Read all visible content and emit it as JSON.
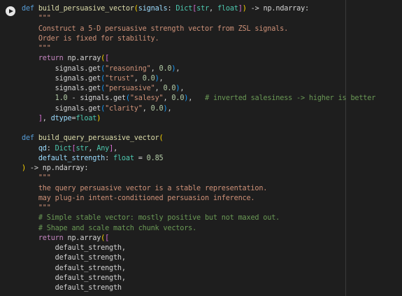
{
  "controls": {
    "run_icon": "play-circle-icon"
  },
  "code": {
    "language": "python",
    "lines": [
      [
        {
          "t": "def",
          "c": "kw"
        },
        {
          "t": " ",
          "c": "plain"
        },
        {
          "t": "build_persuasive_vector",
          "c": "fn"
        },
        {
          "t": "(",
          "c": "br1"
        },
        {
          "t": "signals",
          "c": "var"
        },
        {
          "t": ": ",
          "c": "plain"
        },
        {
          "t": "Dict",
          "c": "ty"
        },
        {
          "t": "[",
          "c": "br2"
        },
        {
          "t": "str",
          "c": "ty"
        },
        {
          "t": ", ",
          "c": "plain"
        },
        {
          "t": "float",
          "c": "ty"
        },
        {
          "t": "]",
          "c": "br2"
        },
        {
          "t": ")",
          "c": "br1"
        },
        {
          "t": " -> ",
          "c": "plain"
        },
        {
          "t": "np.ndarray",
          "c": "plain"
        },
        {
          "t": ":",
          "c": "plain"
        }
      ],
      [
        {
          "t": "    \"\"\"",
          "c": "str"
        }
      ],
      [
        {
          "t": "    Construct a 5-D persuasive strength vector from ZSL signals.",
          "c": "str"
        }
      ],
      [
        {
          "t": "    Order is fixed for stability.",
          "c": "str"
        }
      ],
      [
        {
          "t": "    \"\"\"",
          "c": "str"
        }
      ],
      [
        {
          "t": "    ",
          "c": "plain"
        },
        {
          "t": "return",
          "c": "kw2"
        },
        {
          "t": " np.array",
          "c": "plain"
        },
        {
          "t": "(",
          "c": "br1"
        },
        {
          "t": "[",
          "c": "br2"
        }
      ],
      [
        {
          "t": "        signals.get",
          "c": "plain"
        },
        {
          "t": "(",
          "c": "br3"
        },
        {
          "t": "\"reasoning\"",
          "c": "str"
        },
        {
          "t": ", ",
          "c": "plain"
        },
        {
          "t": "0.0",
          "c": "num"
        },
        {
          "t": ")",
          "c": "br3"
        },
        {
          "t": ",",
          "c": "plain"
        }
      ],
      [
        {
          "t": "        signals.get",
          "c": "plain"
        },
        {
          "t": "(",
          "c": "br3"
        },
        {
          "t": "\"trust\"",
          "c": "str"
        },
        {
          "t": ", ",
          "c": "plain"
        },
        {
          "t": "0.0",
          "c": "num"
        },
        {
          "t": ")",
          "c": "br3"
        },
        {
          "t": ",",
          "c": "plain"
        }
      ],
      [
        {
          "t": "        signals.get",
          "c": "plain"
        },
        {
          "t": "(",
          "c": "br3"
        },
        {
          "t": "\"persuasive\"",
          "c": "str"
        },
        {
          "t": ", ",
          "c": "plain"
        },
        {
          "t": "0.0",
          "c": "num"
        },
        {
          "t": ")",
          "c": "br3"
        },
        {
          "t": ",",
          "c": "plain"
        }
      ],
      [
        {
          "t": "        ",
          "c": "plain"
        },
        {
          "t": "1.0",
          "c": "num"
        },
        {
          "t": " - signals.get",
          "c": "plain"
        },
        {
          "t": "(",
          "c": "br3"
        },
        {
          "t": "\"salesy\"",
          "c": "str"
        },
        {
          "t": ", ",
          "c": "plain"
        },
        {
          "t": "0.0",
          "c": "num"
        },
        {
          "t": ")",
          "c": "br3"
        },
        {
          "t": ",   ",
          "c": "plain"
        },
        {
          "t": "# inverted salesiness -> higher is better",
          "c": "cmt"
        }
      ],
      [
        {
          "t": "        signals.get",
          "c": "plain"
        },
        {
          "t": "(",
          "c": "br3"
        },
        {
          "t": "\"clarity\"",
          "c": "str"
        },
        {
          "t": ", ",
          "c": "plain"
        },
        {
          "t": "0.0",
          "c": "num"
        },
        {
          "t": ")",
          "c": "br3"
        },
        {
          "t": ",",
          "c": "plain"
        }
      ],
      [
        {
          "t": "    ",
          "c": "plain"
        },
        {
          "t": "]",
          "c": "br2"
        },
        {
          "t": ", ",
          "c": "plain"
        },
        {
          "t": "dtype",
          "c": "var"
        },
        {
          "t": "=",
          "c": "plain"
        },
        {
          "t": "float",
          "c": "ty"
        },
        {
          "t": ")",
          "c": "br1"
        }
      ],
      [],
      [
        {
          "t": "def",
          "c": "kw"
        },
        {
          "t": " ",
          "c": "plain"
        },
        {
          "t": "build_query_persuasive_vector",
          "c": "fn"
        },
        {
          "t": "(",
          "c": "br1"
        }
      ],
      [
        {
          "t": "    ",
          "c": "plain"
        },
        {
          "t": "qd",
          "c": "var"
        },
        {
          "t": ": ",
          "c": "plain"
        },
        {
          "t": "Dict",
          "c": "ty"
        },
        {
          "t": "[",
          "c": "br2"
        },
        {
          "t": "str",
          "c": "ty"
        },
        {
          "t": ", ",
          "c": "plain"
        },
        {
          "t": "Any",
          "c": "ty"
        },
        {
          "t": "]",
          "c": "br2"
        },
        {
          "t": ",",
          "c": "plain"
        }
      ],
      [
        {
          "t": "    ",
          "c": "plain"
        },
        {
          "t": "default_strength",
          "c": "var"
        },
        {
          "t": ": ",
          "c": "plain"
        },
        {
          "t": "float",
          "c": "ty"
        },
        {
          "t": " = ",
          "c": "plain"
        },
        {
          "t": "0.85",
          "c": "num"
        }
      ],
      [
        {
          "t": ")",
          "c": "br1"
        },
        {
          "t": " -> ",
          "c": "plain"
        },
        {
          "t": "np.ndarray",
          "c": "plain"
        },
        {
          "t": ":",
          "c": "plain"
        }
      ],
      [
        {
          "t": "    \"\"\"",
          "c": "str"
        }
      ],
      [
        {
          "t": "    the query persuasive vector is a stable representation.",
          "c": "str"
        }
      ],
      [
        {
          "t": "    may plug-in intent-conditioned persuasion inference.",
          "c": "str"
        }
      ],
      [
        {
          "t": "    \"\"\"",
          "c": "str"
        }
      ],
      [
        {
          "t": "    ",
          "c": "plain"
        },
        {
          "t": "# Simple stable vector: mostly positive but not maxed out.",
          "c": "cmt"
        }
      ],
      [
        {
          "t": "    ",
          "c": "plain"
        },
        {
          "t": "# Shape and scale match chunk vectors.",
          "c": "cmt"
        }
      ],
      [
        {
          "t": "    ",
          "c": "plain"
        },
        {
          "t": "return",
          "c": "kw2"
        },
        {
          "t": " np.array",
          "c": "plain"
        },
        {
          "t": "(",
          "c": "br1"
        },
        {
          "t": "[",
          "c": "br2"
        }
      ],
      [
        {
          "t": "        default_strength,",
          "c": "plain"
        }
      ],
      [
        {
          "t": "        default_strength,",
          "c": "plain"
        }
      ],
      [
        {
          "t": "        default_strength,",
          "c": "plain"
        }
      ],
      [
        {
          "t": "        default_strength,",
          "c": "plain"
        }
      ],
      [
        {
          "t": "        default_strength",
          "c": "plain"
        }
      ]
    ]
  }
}
